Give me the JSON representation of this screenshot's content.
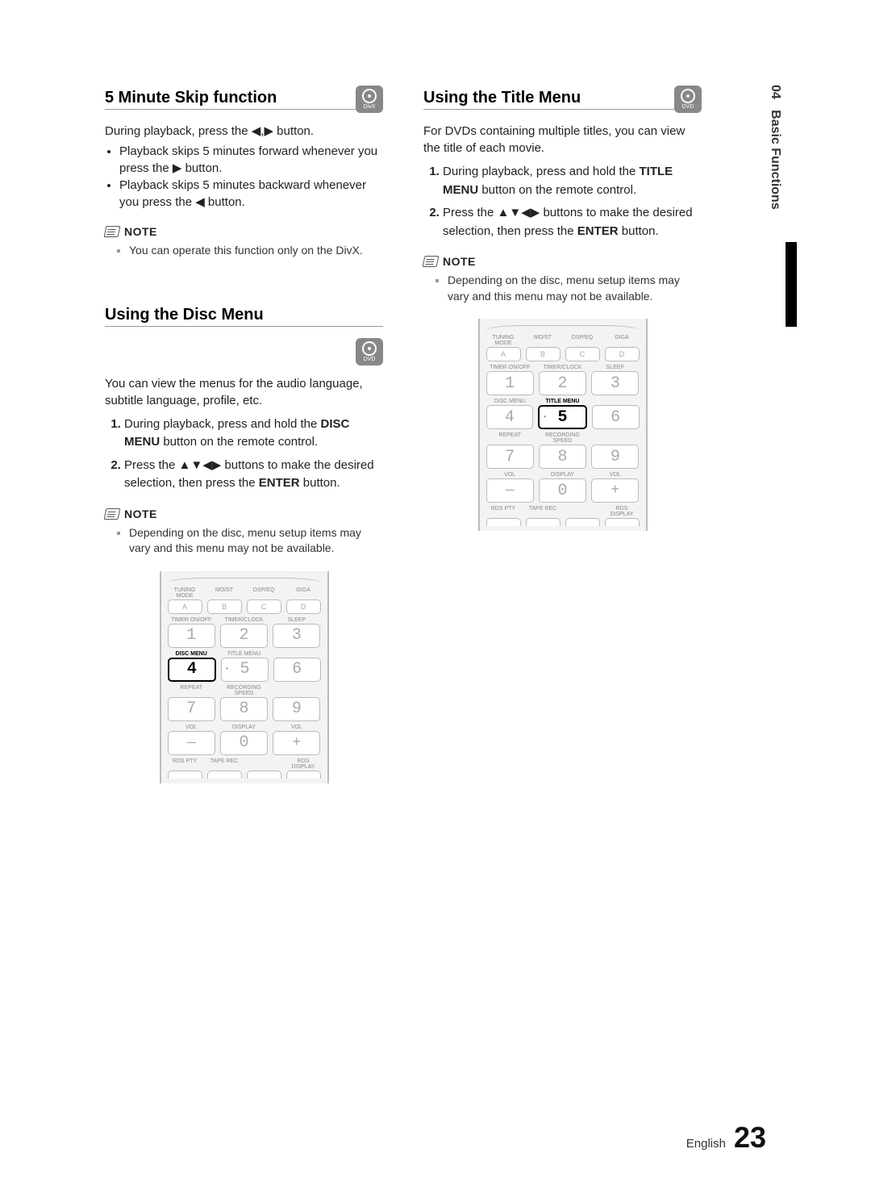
{
  "side_tab": {
    "chapter": "04",
    "title": "Basic Functions"
  },
  "footer": {
    "lang": "English",
    "page": "23"
  },
  "icons": {
    "dvd": "DVD",
    "divx": "DivX"
  },
  "note_label": "NOTE",
  "left": {
    "s1": {
      "title": "5 Minute Skip function",
      "intro_a": "During playback, press the ",
      "intro_b": " button.",
      "b1": "Playback skips 5 minutes forward whenever you press the ▶ button.",
      "b2": "Playback skips 5 minutes backward whenever you press the ◀ button.",
      "note1": "You can operate this function only on the DivX."
    },
    "s2": {
      "title": "Using the Disc Menu",
      "intro": "You can view the menus for the audio language, subtitle language, profile, etc.",
      "li1_a": "During playback, press and hold the ",
      "li1_b": "DISC MENU",
      "li1_c": " button on the remote control.",
      "li2_a": "Press the ",
      "li2_b": " buttons to make the desired selection, then press the ",
      "li2_c": "ENTER",
      "li2_d": " button.",
      "note1": "Depending on the disc, menu setup items may vary and this menu may not be available."
    }
  },
  "right": {
    "s1": {
      "title": "Using the Title Menu",
      "intro": "For DVDs containing multiple titles, you can view the title of each movie.",
      "li1_a": "During playback, press and hold the ",
      "li1_b": "TITLE MENU",
      "li1_c": " button on the remote control.",
      "li2_a": "Press the ",
      "li2_b": " buttons to make the desired selection, then press the ",
      "li2_c": "ENTER",
      "li2_d": " button.",
      "note1": "Depending on the disc, menu setup items may vary and this menu may not be available."
    }
  },
  "remote": {
    "row1_labels": [
      "TUNING MODE",
      "MO/ST",
      "DSP/EQ",
      "GIGA"
    ],
    "row1": [
      "A",
      "B",
      "C",
      "D"
    ],
    "row2_labels": [
      "TIMER ON/OFF",
      "TIMER/CLOCK",
      "SLEEP"
    ],
    "row2": [
      "1",
      "2",
      "3"
    ],
    "row3_labels": [
      "DISC MENU",
      "TITLE MENU",
      ""
    ],
    "row3": [
      "4",
      "5",
      "6"
    ],
    "row4_labels": [
      "REPEAT",
      "RECORDING SPEED",
      ""
    ],
    "row4": [
      "7",
      "8",
      "9"
    ],
    "row5_labels": [
      "VOL",
      "DISPLAY",
      "VOL"
    ],
    "row5": [
      "—",
      "0",
      "+"
    ],
    "row6_labels": [
      "RDS PTY",
      "TAPE REC",
      "",
      "RDS DISPLAY"
    ],
    "row6": [
      "",
      "",
      "",
      ""
    ]
  }
}
